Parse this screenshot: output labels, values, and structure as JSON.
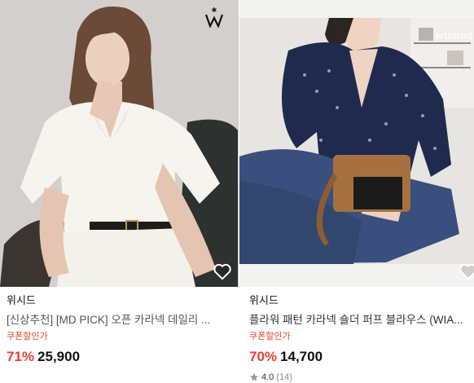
{
  "products": [
    {
      "seller": "위시드",
      "title": "[신상추천] [MD PICK] 오픈 카라넥 데일리 ...",
      "coupon_label": "쿠폰할인가",
      "discount": "71%",
      "price": "25,900",
      "brand_logo": "W",
      "favorite_icon": "heart-outline-icon"
    },
    {
      "seller": "위시드",
      "title": "플라워 패턴 카라넥 숄더 퍼프 블라우스 (WIA...",
      "coupon_label": "쿠폰할인가",
      "discount": "70%",
      "price": "14,700",
      "rating_score": "4.0",
      "rating_count": "(14)",
      "photo_watermark": "wished",
      "favorite_icon": "heart-outline-icon"
    }
  ],
  "colors": {
    "discount": "#e4422e",
    "coupon": "#e4422e",
    "star": "#999999"
  }
}
